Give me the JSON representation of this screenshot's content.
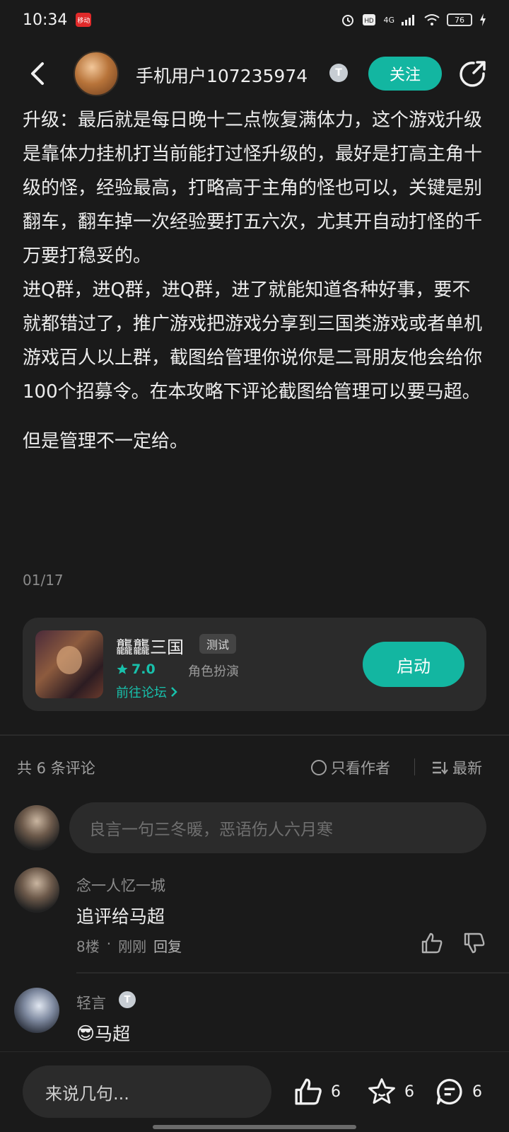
{
  "status_bar": {
    "time": "10:34",
    "app_badge": "移动",
    "network": "4G",
    "battery": "76"
  },
  "header": {
    "author_name": "手机用户107235974",
    "author_badge": "T",
    "follow_label": "关注"
  },
  "article": {
    "paragraphs": [
      "升级：最后就是每日晚十二点恢复满体力，这个游戏升级是靠体力挂机打当前能打过怪升级的，最好是打高主角十级的怪，经验最高，打略高于主角的怪也可以，关键是别翻车，翻车掉一次经验要打五六次，尤其开自动打怪的千万要打稳妥的。",
      "进Q群，进Q群，进Q群，进了就能知道各种好事，要不就都错过了，推广游戏把游戏分享到三国类游戏或者单机游戏百人以上群，截图给管理你说你是二哥朋友他会给你100个招募令。在本攻略下评论截图给管理可以要马超。",
      "但是管理不一定给。"
    ],
    "page_counter": "01/17"
  },
  "game_card": {
    "title": "龘龘三国",
    "tag": "测试",
    "rating": "7.0",
    "genre": "角色扮演",
    "forum_link": "前往论坛",
    "launch_label": "启动"
  },
  "comments": {
    "count_label": "共 6 条评论",
    "author_only_label": "只看作者",
    "sort_label": "最新",
    "input_placeholder": "良言一句三冬暖，恶语伤人六月寒",
    "items": [
      {
        "name": "念一人忆一城",
        "text": "追评给马超",
        "floor": "8楼",
        "dot": "·",
        "time": "刚刚",
        "reply_label": "回复"
      },
      {
        "name": "轻言",
        "badge": "T",
        "emoji": "😎",
        "text": "马超"
      }
    ]
  },
  "bottom_bar": {
    "reply_placeholder": "来说几句...",
    "likes": "6",
    "favorites": "6",
    "comments": "6"
  },
  "colors": {
    "accent": "#13b6a1",
    "background": "#1a1a1a",
    "card": "#2b2b2b"
  },
  "icons": [
    "back-arrow-icon",
    "share-icon",
    "star-icon",
    "chevron-right-icon",
    "sort-icon",
    "thumb-up-icon",
    "thumb-down-icon",
    "star-outline-icon",
    "chat-bubble-icon"
  ]
}
